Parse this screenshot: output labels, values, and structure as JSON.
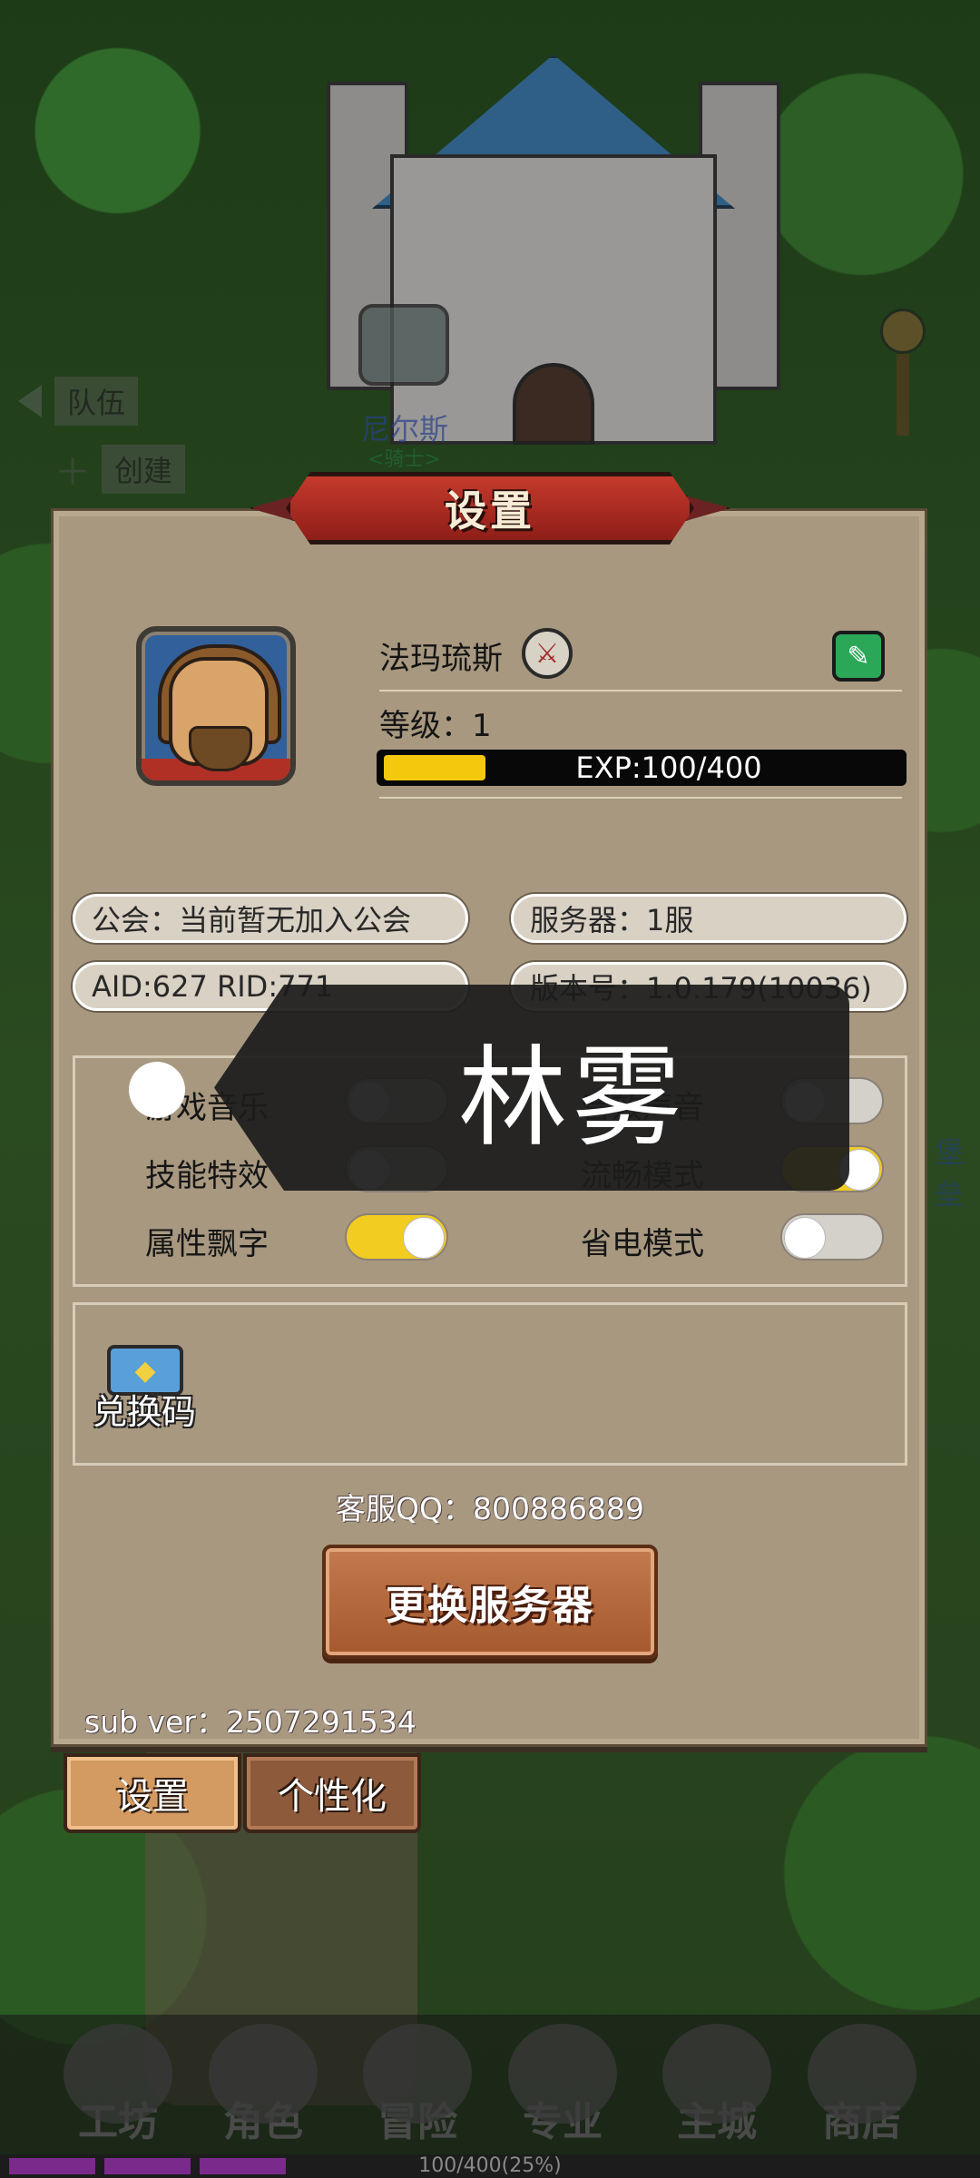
{
  "background": {
    "team_tab": "队伍",
    "create_tab": "创建",
    "npc_name": "尼尔斯",
    "npc_subtitle": "<骑士>",
    "right_edge_text": "堡垒"
  },
  "panel": {
    "title": "设置",
    "player": {
      "name": "法玛琉斯",
      "level_label": "等级：1",
      "exp_text": "EXP:100/400",
      "exp_fraction": 0.25
    },
    "info": {
      "guild": "公会：当前暂无加入公会",
      "server": "服务器：1服",
      "ids": "AID:627  RID:771",
      "version": "版本号：1.0.179(10036)"
    },
    "toggles": [
      {
        "label": "游戏音乐",
        "on": false
      },
      {
        "label": "音效声音",
        "on": false
      },
      {
        "label": "技能特效",
        "on": false
      },
      {
        "label": "流畅模式",
        "on": true
      },
      {
        "label": "属性飘字",
        "on": true
      },
      {
        "label": "省电模式",
        "on": false
      }
    ],
    "redeem_label": "兑换码",
    "customer_service": "客服QQ：800886889",
    "change_server_button": "更换服务器",
    "sub_version": "sub ver：2507291534"
  },
  "tabs": {
    "settings": "设置",
    "personalize": "个性化"
  },
  "bottom_nav": [
    "工坊",
    "角色",
    "冒险",
    "专业",
    "主城",
    "商店"
  ],
  "xp_strip_text": "100/400(25%)",
  "toast": {
    "text": "林雾"
  },
  "colors": {
    "panel_bg": "#a89880",
    "title_red": "#c53a2c",
    "exp_yellow": "#f3c80d",
    "toggle_on": "#f2cc20",
    "button_orange": "#b36438",
    "edit_green": "#2aa858"
  },
  "icons": {
    "edit": "pencil-icon",
    "class": "sword-icon",
    "redeem": "chest-icon",
    "back": "triangle-left-icon",
    "create": "plus-icon"
  }
}
